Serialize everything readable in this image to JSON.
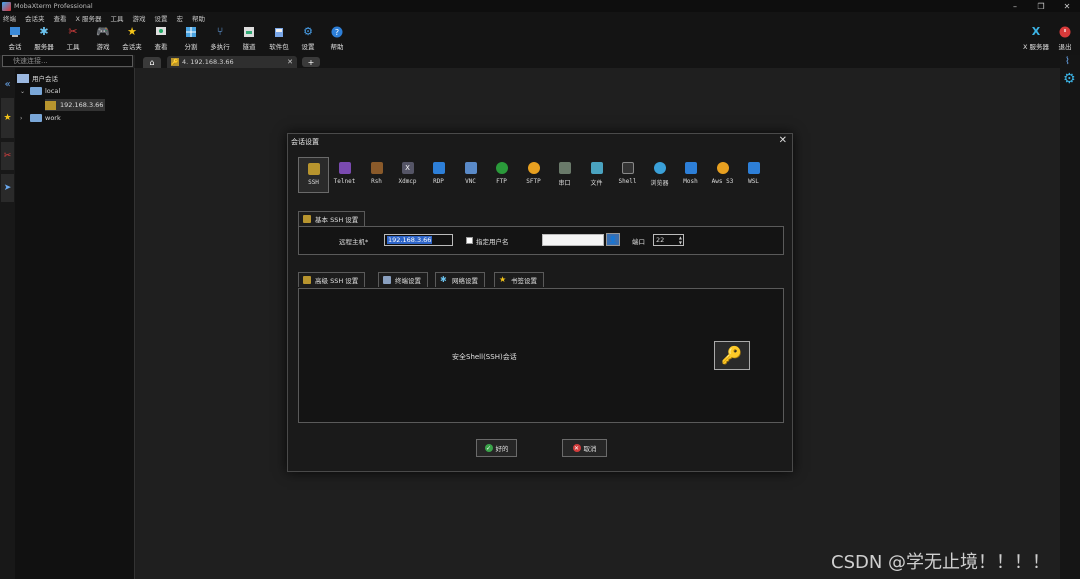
{
  "window": {
    "title": "MobaXterm Professional"
  },
  "menu": [
    "终端",
    "会话夹",
    "查看",
    "X 服务器",
    "工具",
    "游戏",
    "设置",
    "宏",
    "帮助"
  ],
  "toolbar": {
    "items": [
      "会话",
      "服务器",
      "工具",
      "游戏",
      "会话夹",
      "查看",
      "分割",
      "多执行",
      "隧道",
      "软件包",
      "设置",
      "帮助"
    ],
    "right": [
      "X 服务器",
      "退出"
    ]
  },
  "quick_connect": {
    "placeholder": "快速连接..."
  },
  "tabs": {
    "session_tab": "4. 192.168.3.66"
  },
  "sidebar": {
    "root": "用户会话",
    "local": "local",
    "host": "192.168.3.66",
    "work": "work"
  },
  "dialog": {
    "title": "会话设置",
    "protocols": [
      "SSH",
      "Telnet",
      "Rsh",
      "Xdmcp",
      "RDP",
      "VNC",
      "FTP",
      "SFTP",
      "串口",
      "文件",
      "Shell",
      "浏览器",
      "Mosh",
      "Aws S3",
      "WSL"
    ],
    "basic_tab": "基本 SSH 设置",
    "remote_host_label": "远程主机*",
    "remote_host_value": "192.168.3.66",
    "specify_user_label": "指定用户名",
    "port_label": "端口",
    "port_value": "22",
    "adv_tabs": [
      "高级 SSH 设置",
      "终端设置",
      "网络设置",
      "书签设置"
    ],
    "description": "安全Shell(SSH)会话",
    "ok": "好的",
    "cancel": "取消"
  },
  "watermark": "CSDN @学无止境！！！！",
  "colors": {
    "background": "#1e1e1e",
    "accent": "#2d64c8",
    "ok_green": "#3aa34a",
    "cancel_red": "#d23c3c"
  }
}
